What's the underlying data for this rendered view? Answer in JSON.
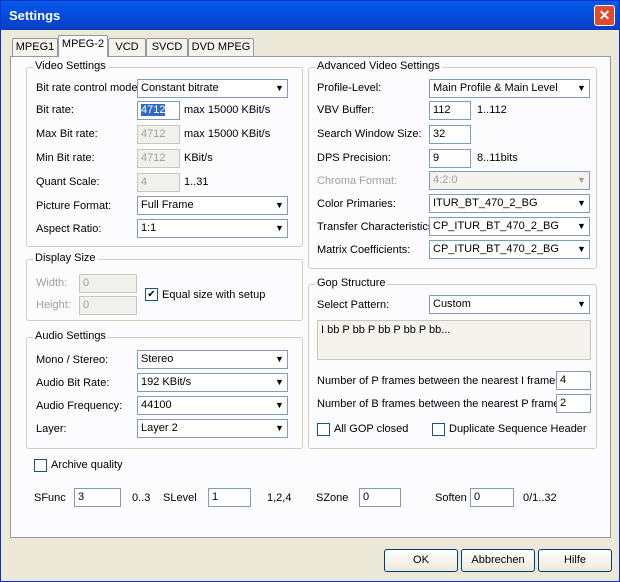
{
  "window": {
    "title": "Settings",
    "close": "✕"
  },
  "tabs": [
    {
      "label": "MPEG1"
    },
    {
      "label": "MPEG-2"
    },
    {
      "label": "VCD"
    },
    {
      "label": "SVCD"
    },
    {
      "label": "DVD MPEG"
    }
  ],
  "video": {
    "title": "Video Settings",
    "bitrate_mode_label": "Bit rate control mode:",
    "bitrate_mode": "Constant bitrate",
    "bitrate_label": "Bit rate:",
    "bitrate_value": "4712",
    "bitrate_hint": "max 15000 KBit/s",
    "max_bitrate_label": "Max Bit rate:",
    "max_bitrate_value": "4712",
    "max_bitrate_hint": "max 15000 KBit/s",
    "min_bitrate_label": "Min Bit rate:",
    "min_bitrate_value": "4712",
    "min_bitrate_hint": "KBit/s",
    "quant_label": "Quant Scale:",
    "quant_value": "4",
    "quant_hint": "1..31",
    "picture_label": "Picture Format:",
    "picture_value": "Full Frame",
    "aspect_label": "Aspect Ratio:",
    "aspect_value": "1:1"
  },
  "display": {
    "title": "Display Size",
    "width_label": "Width:",
    "width_value": "0",
    "height_label": "Height:",
    "height_value": "0",
    "equal_label": "Equal size with setup",
    "equal_checked": "✔"
  },
  "audio": {
    "title": "Audio Settings",
    "mono_label": "Mono / Stereo:",
    "mono_value": "Stereo",
    "rate_label": "Audio Bit Rate:",
    "rate_value": "192 KBit/s",
    "freq_label": "Audio Frequency:",
    "freq_value": "44100",
    "layer_label": "Layer:",
    "layer_value": "Layer 2"
  },
  "archive_label": "Archive quality",
  "bottom": {
    "sfunc_label": "SFunc",
    "sfunc_value": "3",
    "sfunc_hint": "0..3",
    "slevel_label": "SLevel",
    "slevel_value": "1",
    "slevel_hint": "1,2,4",
    "szone_label": "SZone",
    "szone_value": "0",
    "soften_label": "Soften",
    "soften_value": "0",
    "soften_hint": "0/1..32"
  },
  "advanced": {
    "title": "Advanced Video Settings",
    "profile_label": "Profile-Level:",
    "profile_value": "Main Profile & Main Level",
    "vbv_label": "VBV Buffer:",
    "vbv_value": "112",
    "vbv_hint": "1..112",
    "search_label": "Search Window Size:",
    "search_value": "32",
    "dps_label": "DPS Precision:",
    "dps_value": "9",
    "dps_hint": "8..11bits",
    "chroma_label": "Chroma Format:",
    "chroma_value": "4:2:0",
    "color_label": "Color Primaries:",
    "color_value": "ITUR_BT_470_2_BG",
    "transfer_label": "Transfer Characteristics:",
    "transfer_value": "CP_ITUR_BT_470_2_BG",
    "matrix_label": "Matrix Coefficients:",
    "matrix_value": "CP_ITUR_BT_470_2_BG"
  },
  "gop": {
    "title": "Gop Structure",
    "pattern_label": "Select Pattern:",
    "pattern_value": "Custom",
    "pattern_text": "I bb P bb P bb P bb P bb...",
    "p_label": "Number of P frames between the nearest I frames:",
    "p_value": "4",
    "b_label": "Number of B frames between the nearest P frames:",
    "b_value": "2",
    "closed_label": "All GOP closed",
    "dup_label": "Duplicate Sequence Header"
  },
  "buttons": {
    "ok": "OK",
    "cancel": "Abbrechen",
    "help": "Hilfe"
  },
  "icons": {
    "dropdown": "▼"
  }
}
